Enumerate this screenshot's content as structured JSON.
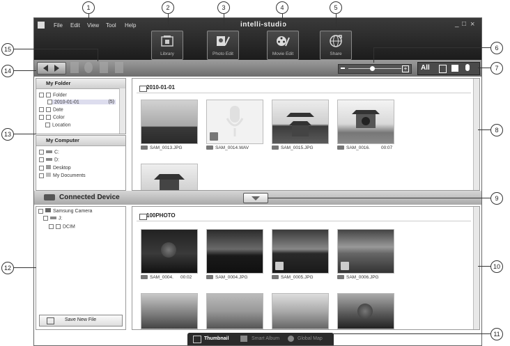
{
  "menu": [
    "File",
    "Edit",
    "View",
    "Tool",
    "Help"
  ],
  "brand": "intelli-studio",
  "window_controls": {
    "minimize": "_",
    "maximize": "□",
    "close": "×"
  },
  "modes": [
    {
      "label": "Library",
      "icon": "library-icon"
    },
    {
      "label": "Photo Edit",
      "icon": "photo-edit-icon"
    },
    {
      "label": "Movie Edit",
      "icon": "movie-edit-icon"
    },
    {
      "label": "Share",
      "icon": "share-globe-icon"
    }
  ],
  "view_filters": {
    "all": "All"
  },
  "zoom_level": 0.45,
  "my_folder": {
    "title": "My Folder",
    "items": [
      {
        "label": "Folder"
      },
      {
        "label": "2010-01-01",
        "count": "(5)"
      },
      {
        "label": "Date"
      },
      {
        "label": "Color"
      },
      {
        "label": "Location"
      }
    ]
  },
  "my_computer": {
    "title": "My Computer",
    "items": [
      "C:",
      "D:",
      "Desktop",
      "My Documents"
    ]
  },
  "top_folder": {
    "name": "2010-01-01",
    "files": [
      {
        "name": "SAM_0013.JPG",
        "duration": ""
      },
      {
        "name": "SAM_0014.WAV",
        "duration": ""
      },
      {
        "name": "SAM_0015.JPG",
        "duration": ""
      },
      {
        "name": "SAM_0016.",
        "duration": "00:07"
      }
    ]
  },
  "connected_device": {
    "title": "Connected Device",
    "tree": [
      "Samsung Camera",
      "J:",
      "DCIM"
    ],
    "save_button": "Save New File"
  },
  "bottom_folder": {
    "name": "100PHOTO",
    "files": [
      {
        "name": "SAM_0004.",
        "duration": "00:02"
      },
      {
        "name": "SAM_0004.JPG",
        "duration": ""
      },
      {
        "name": "SAM_0005.JPG",
        "duration": ""
      },
      {
        "name": "SAM_0006.JPG",
        "duration": ""
      }
    ]
  },
  "bottom_tabs": [
    "Thumbnail",
    "Smart Album",
    "Global Map"
  ],
  "callouts": [
    "1",
    "2",
    "3",
    "4",
    "5",
    "6",
    "7",
    "8",
    "9",
    "10",
    "11",
    "12",
    "13",
    "14",
    "15"
  ]
}
